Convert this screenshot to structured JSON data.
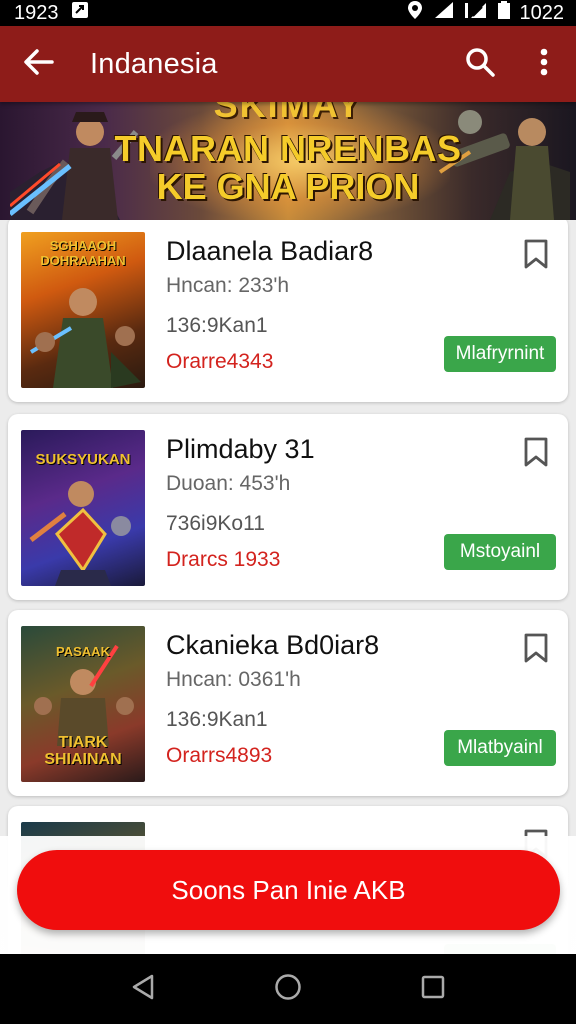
{
  "status_bar": {
    "time": "1923",
    "battery_text": "1022"
  },
  "app_bar": {
    "title": "Indanesia"
  },
  "banner": {
    "top_text": "SKIMAY",
    "line1": "TNARAN NRENBAS",
    "line2": "KE GNA PRION"
  },
  "items": [
    {
      "name": "Dlaanela Badiar8",
      "meta": "Hncan: 233'h",
      "size": "136:9Kan1",
      "price": "Orarre4343",
      "badge": "Mlafryrnint",
      "thumb_title": "SGHAAOH DOHRAAHAN",
      "thumb_bottom": ""
    },
    {
      "name": "Plimdaby 31",
      "meta": "Duoan: 453'h",
      "size": "736i9Ko11",
      "price": "Drarcs 1933",
      "badge": "Mstoyainl",
      "thumb_title": "SUKSYUKAN",
      "thumb_bottom": ""
    },
    {
      "name": "Ckanieka Bd0iar8",
      "meta": "Hncan: 0361'h",
      "size": "136:9Kan1",
      "price": "Orarrs4893",
      "badge": "Mlatbyainl",
      "thumb_title": "PASAAK",
      "thumb_bottom": "TIARK SHIAINAN"
    }
  ],
  "cta": {
    "label": "Soons Pan Inie AKB"
  }
}
